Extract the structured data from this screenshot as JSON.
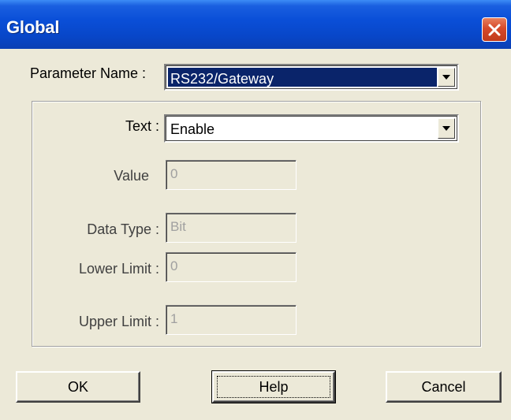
{
  "window": {
    "title": "Global"
  },
  "param_name": {
    "label": "Parameter Name :",
    "value": "RS232/Gateway"
  },
  "text": {
    "label": "Text :",
    "value": "Enable"
  },
  "value": {
    "label": "Value",
    "value": "0"
  },
  "data_type": {
    "label": "Data Type :",
    "value": "Bit"
  },
  "lower_limit": {
    "label": "Lower Limit :",
    "value": "0"
  },
  "upper_limit": {
    "label": "Upper Limit :",
    "value": "1"
  },
  "buttons": {
    "ok": "OK",
    "help": "Help",
    "cancel": "Cancel"
  },
  "icons": {
    "close": "close-icon",
    "dropdown": "chevron-down-icon"
  },
  "colors": {
    "titlebar": "#0a4fd8",
    "close": "#d6492a",
    "selection": "#0a246a",
    "face": "#ece9d8"
  }
}
